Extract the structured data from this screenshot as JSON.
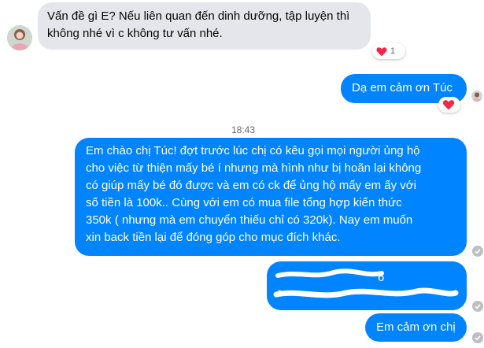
{
  "colors": {
    "incoming_bg": "#e4e6eb",
    "outgoing_bg": "#0084ff",
    "heart": "#f02849",
    "seen_icon": "#bcc0c4",
    "scribble": "#ffffff"
  },
  "messages": [
    {
      "id": "m1",
      "direction": "incoming",
      "lines": [
        "Vấn đề gì E? Nếu liên quan đến dinh dưỡng, tập luyện thì",
        "không nhé vì c không tư vấn nhé."
      ],
      "reaction": {
        "icon": "heart-icon",
        "count": "1"
      }
    },
    {
      "id": "m2",
      "direction": "outgoing",
      "lines": [
        "Dạ em cảm ơn Túc"
      ],
      "reaction": {
        "icon": "heart-icon",
        "count": ""
      }
    },
    {
      "id": "m3",
      "direction": "outgoing",
      "lines": [
        "Em chào chị Túc! đợt trước lúc chị có kêu gọi mọi người ủng hộ",
        "cho việc từ thiện mấy bé í nhưng mà hình như bị hoãn lại không",
        "có giúp mấy bé đó được và em có ck để ủng hộ mấy em ấy  với",
        "số tiền là 100k.. Cùng với em có mua file tổng hợp kiến thức",
        "350k ( nhưng mà em chuyển thiếu chỉ có 320k). Nay em muốn",
        "xin back tiền lại để đóng góp cho mục đích khác."
      ]
    },
    {
      "id": "m4",
      "direction": "outgoing",
      "redacted": true,
      "lines": [
        "6",
        ""
      ]
    },
    {
      "id": "m5",
      "direction": "outgoing",
      "lines": [
        "Em cảm ơn chị"
      ]
    }
  ],
  "timestamp": "18:43",
  "icons": {
    "incoming_avatar": "avatar-icon",
    "seen": "seen-check-icon"
  }
}
